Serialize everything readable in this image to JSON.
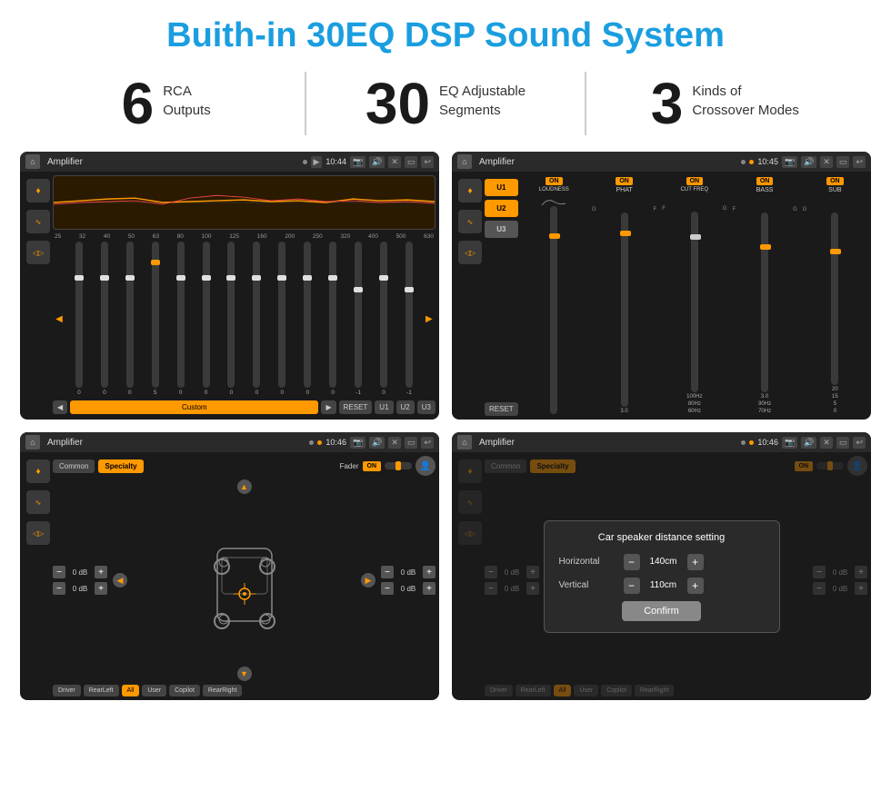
{
  "page": {
    "title": "Buith-in 30EQ DSP Sound System",
    "stats": [
      {
        "number": "6",
        "desc_line1": "RCA",
        "desc_line2": "Outputs"
      },
      {
        "number": "30",
        "desc_line1": "EQ Adjustable",
        "desc_line2": "Segments"
      },
      {
        "number": "3",
        "desc_line1": "Kinds of",
        "desc_line2": "Crossover Modes"
      }
    ]
  },
  "screen1": {
    "status_bar": {
      "title": "Amplifier",
      "time": "10:44"
    },
    "eq_freqs": [
      "25",
      "32",
      "40",
      "50",
      "63",
      "80",
      "100",
      "125",
      "160",
      "200",
      "250",
      "320",
      "400",
      "500",
      "630"
    ],
    "eq_values": [
      "0",
      "0",
      "0",
      "5",
      "0",
      "0",
      "0",
      "0",
      "0",
      "0",
      "0",
      "-1",
      "0",
      "-1"
    ],
    "eq_preset": "Custom",
    "buttons": [
      "RESET",
      "U1",
      "U2",
      "U3"
    ]
  },
  "screen2": {
    "status_bar": {
      "title": "Amplifier",
      "time": "10:45"
    },
    "u_buttons": [
      "U1",
      "U2",
      "U3"
    ],
    "channels": [
      {
        "name": "LOUDNESS",
        "on": true
      },
      {
        "name": "PHAT",
        "on": true
      },
      {
        "name": "CUT FREQ",
        "on": true
      },
      {
        "name": "BASS",
        "on": true
      },
      {
        "name": "SUB",
        "on": true
      }
    ],
    "reset_label": "RESET"
  },
  "screen3": {
    "status_bar": {
      "title": "Amplifier",
      "time": "10:46"
    },
    "tabs": [
      "Common",
      "Specialty"
    ],
    "active_tab": "Specialty",
    "fader_label": "Fader",
    "fader_on": "ON",
    "positions": [
      "Driver",
      "Copilot",
      "RearLeft",
      "All",
      "User",
      "RearRight"
    ],
    "volume_rows": [
      {
        "value": "0 dB"
      },
      {
        "value": "0 dB"
      },
      {
        "value": "0 dB"
      },
      {
        "value": "0 dB"
      }
    ]
  },
  "screen4": {
    "status_bar": {
      "title": "Amplifier",
      "time": "10:46"
    },
    "tabs": [
      "Common",
      "Specialty"
    ],
    "active_tab": "Specialty",
    "fader_on": "ON",
    "dialog": {
      "title": "Car speaker distance setting",
      "horizontal_label": "Horizontal",
      "horizontal_value": "140cm",
      "vertical_label": "Vertical",
      "vertical_value": "110cm",
      "confirm_label": "Confirm"
    },
    "positions": [
      "Driver",
      "Copilot",
      "RearLeft",
      "User",
      "RearRight"
    ],
    "volume_rows": [
      {
        "value": "0 dB"
      },
      {
        "value": "0 dB"
      }
    ]
  },
  "icons": {
    "home": "⌂",
    "play": "▶",
    "back": "◀",
    "location": "📍",
    "volume": "🔊",
    "settings": "⚙",
    "eq": "≋",
    "wave": "∿",
    "speaker": "🔉",
    "arrow_right": "›",
    "arrow_left": "‹",
    "arrow_up": "▲",
    "arrow_down": "▼",
    "return": "↩",
    "minus": "−",
    "plus": "+"
  }
}
